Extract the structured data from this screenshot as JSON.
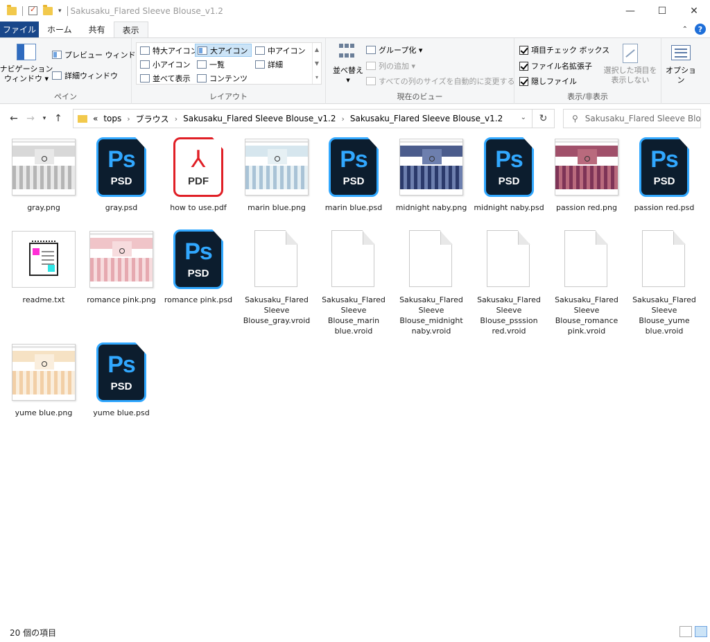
{
  "window": {
    "title": "Sakusaku_Flared Sleeve Blouse_v1.2",
    "minimize": "—",
    "maximize": "☐",
    "close": "✕"
  },
  "tabs": [
    "ファイル",
    "ホーム",
    "共有",
    "表示"
  ],
  "ribbon": {
    "pane": {
      "nav_label": "ナビゲーション\nウィンドウ ▾",
      "preview": "プレビュー ウィンドウ",
      "details": "詳細ウィンドウ",
      "group": "ペイン"
    },
    "layout": {
      "items": [
        "特大アイコン",
        "大アイコン",
        "中アイコン",
        "小アイコン",
        "一覧",
        "詳細",
        "並べて表示",
        "コンテンツ"
      ],
      "selected": "大アイコン",
      "group": "レイアウト"
    },
    "view": {
      "sort": "並べ替え",
      "group_by": "グループ化 ▾",
      "add_column": "列の追加 ▾",
      "autosize": "すべての列のサイズを自動的に変更する",
      "group": "現在のビュー"
    },
    "showhide": {
      "item_checkbox": "項目チェック ボックス",
      "extensions": "ファイル名拡張子",
      "hidden": "隠しファイル",
      "hide_selected": "選択した項目を\n表示しない",
      "group": "表示/非表示"
    },
    "options": "オプション"
  },
  "address": {
    "prefix": "«",
    "crumbs": [
      "tops",
      "ブラウス",
      "Sakusaku_Flared Sleeve Blouse_v1.2",
      "Sakusaku_Flared Sleeve Blouse_v1.2"
    ],
    "search_placeholder": "Sakusaku_Flared Sleeve Blou..."
  },
  "files": [
    {
      "name": "gray.png",
      "kind": "png",
      "colors": [
        "#d8d8d8",
        "#b5b5b5",
        "#e8e8e8"
      ]
    },
    {
      "name": "gray.psd",
      "kind": "psd"
    },
    {
      "name": "how to use.pdf",
      "kind": "pdf"
    },
    {
      "name": "marin blue.png",
      "kind": "png",
      "colors": [
        "#d6e6ee",
        "#a9c3d6",
        "#e6f0f4"
      ]
    },
    {
      "name": "marin blue.psd",
      "kind": "psd"
    },
    {
      "name": "midnight naby.png",
      "kind": "png",
      "colors": [
        "#4b5c8c",
        "#2b3a6b",
        "#6d7fae"
      ]
    },
    {
      "name": "midnight naby.psd",
      "kind": "psd"
    },
    {
      "name": "passion red.png",
      "kind": "png",
      "colors": [
        "#a0506a",
        "#7e3457",
        "#b96a7d"
      ]
    },
    {
      "name": "passion red.psd",
      "kind": "psd"
    },
    {
      "name": "readme.txt",
      "kind": "txt"
    },
    {
      "name": "romance pink.png",
      "kind": "png",
      "colors": [
        "#f0c4c8",
        "#e6a9b0",
        "#f7dcde"
      ]
    },
    {
      "name": "romance pink.psd",
      "kind": "psd"
    },
    {
      "name": "Sakusaku_Flared Sleeve Blouse_gray.vroid",
      "kind": "vroid"
    },
    {
      "name": "Sakusaku_Flared Sleeve Blouse_marin blue.vroid",
      "kind": "vroid"
    },
    {
      "name": "Sakusaku_Flared Sleeve Blouse_midnight naby.vroid",
      "kind": "vroid"
    },
    {
      "name": "Sakusaku_Flared Sleeve Blouse_psssion red.vroid",
      "kind": "vroid"
    },
    {
      "name": "Sakusaku_Flared Sleeve Blouse_romance pink.vroid",
      "kind": "vroid"
    },
    {
      "name": "Sakusaku_Flared Sleeve Blouse_yume blue.vroid",
      "kind": "vroid"
    },
    {
      "name": "yume blue.png",
      "kind": "png",
      "colors": [
        "#f6e2c4",
        "#f2cfa6",
        "#faeedd"
      ]
    },
    {
      "name": "yume blue.psd",
      "kind": "psd"
    }
  ],
  "status": {
    "count": "20 個の項目"
  },
  "icons": {
    "psd_text": "Ps",
    "psd_label": "PSD",
    "pdf_label": "PDF",
    "acrobat": "⅄"
  }
}
